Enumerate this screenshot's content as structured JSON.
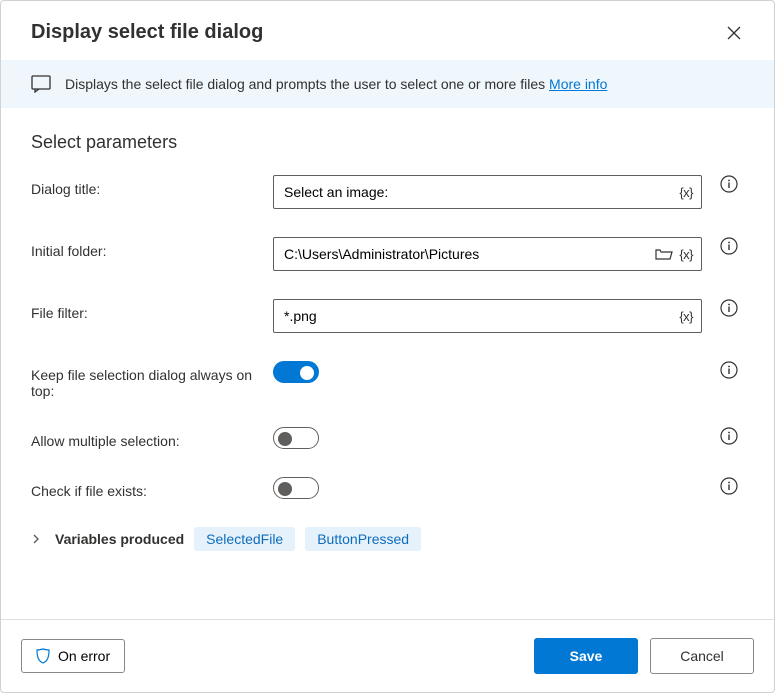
{
  "header": {
    "title": "Display select file dialog"
  },
  "banner": {
    "text": "Displays the select file dialog and prompts the user to select one or more files ",
    "link_text": "More info"
  },
  "section_title": "Select parameters",
  "fields": {
    "dialog_title": {
      "label": "Dialog title:",
      "value": "Select an image:"
    },
    "initial_folder": {
      "label": "Initial folder:",
      "value": "C:\\Users\\Administrator\\Pictures"
    },
    "file_filter": {
      "label": "File filter:",
      "value": "*.png"
    },
    "keep_on_top": {
      "label": "Keep file selection dialog always on top:",
      "value": true
    },
    "allow_multiple": {
      "label": "Allow multiple selection:",
      "value": false
    },
    "check_exists": {
      "label": "Check if file exists:",
      "value": false
    }
  },
  "variables": {
    "label": "Variables produced",
    "chips": [
      "SelectedFile",
      "ButtonPressed"
    ]
  },
  "footer": {
    "on_error": "On error",
    "save": "Save",
    "cancel": "Cancel"
  }
}
